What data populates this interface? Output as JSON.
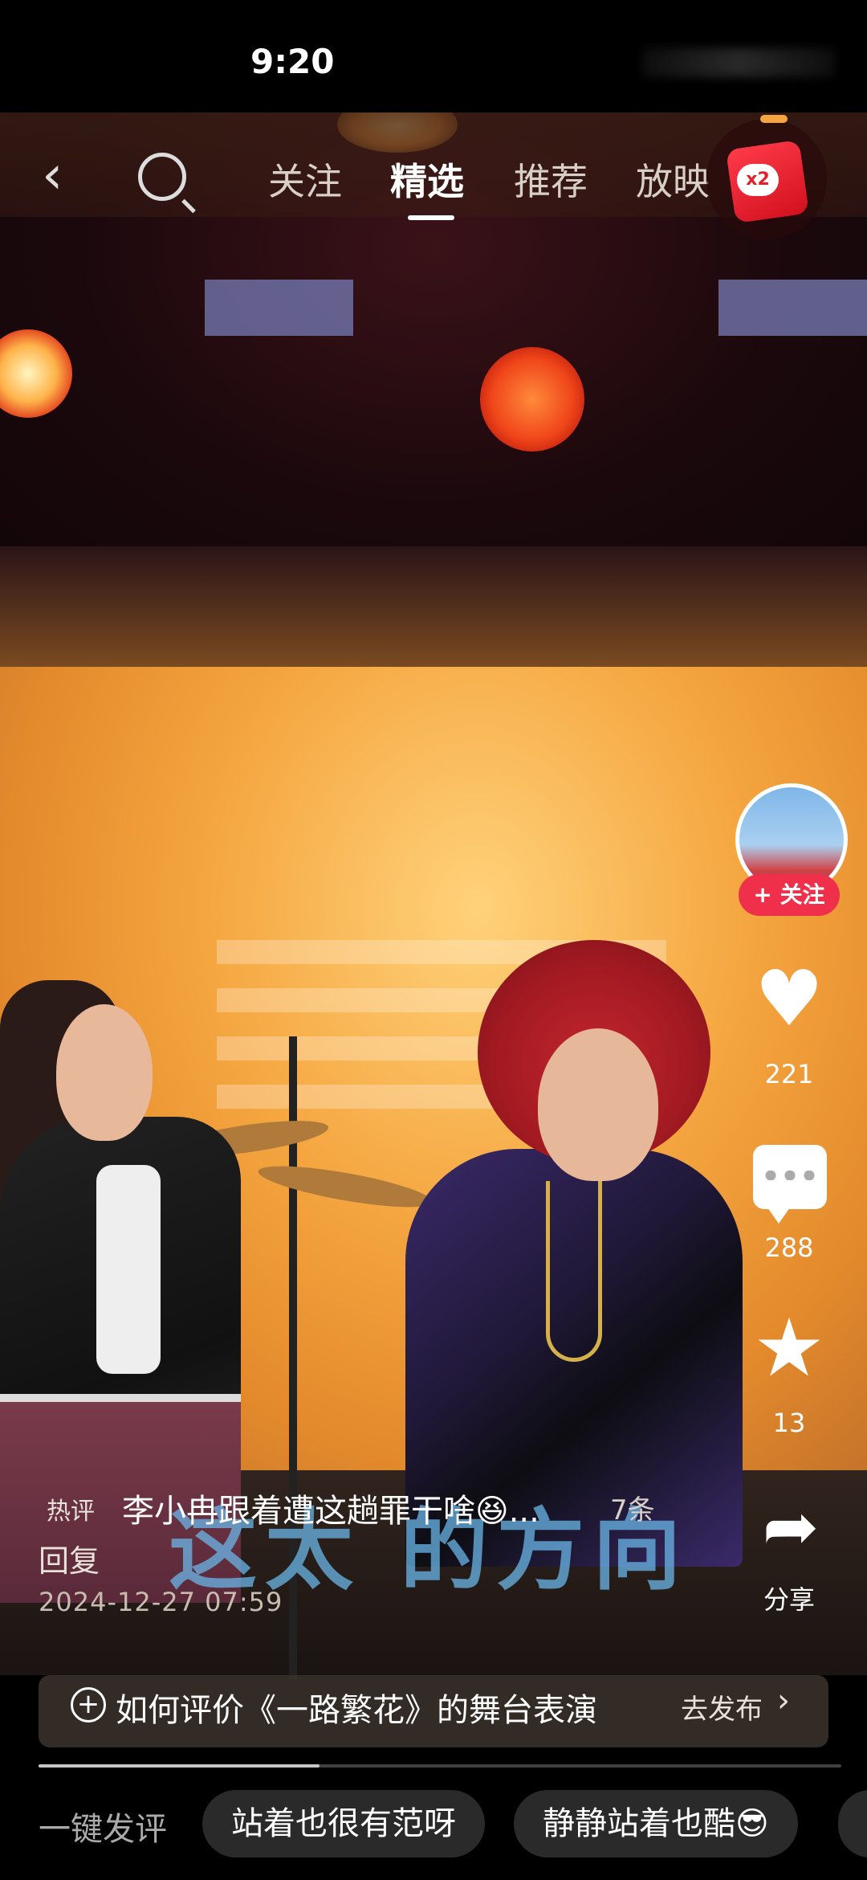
{
  "status_bar": {
    "time": "9:20"
  },
  "nav": {
    "tabs": [
      "关注",
      "精选",
      "推荐",
      "放映"
    ],
    "active_tab": "精选",
    "red_packet_badge": "x2"
  },
  "author": {
    "follow_label": "+ 关注"
  },
  "actions": {
    "like_count": "221",
    "comment_count": "288",
    "favorite_count": "13",
    "share_label": "分享"
  },
  "hot_comment": {
    "label": "热评",
    "text": "李小冉跟着遭这趟罪干啥😆...",
    "count_suffix": "7条",
    "reply_label": "回复",
    "timestamp": "2024-12-27 07:59"
  },
  "subtitle": "这太 的方向",
  "topic": {
    "icon": "+",
    "text": "如何评价《一路繁花》的舞台表演",
    "action": "去发布",
    "chevron": "›"
  },
  "progress": {
    "fraction": 0.35
  },
  "quick_comment": {
    "label": "一键发评",
    "chips": [
      "站着也很有范呀",
      "静静站着也酷😎"
    ]
  },
  "colors": {
    "accent_red": "#f0304a",
    "red_packet": "#e0202a"
  }
}
